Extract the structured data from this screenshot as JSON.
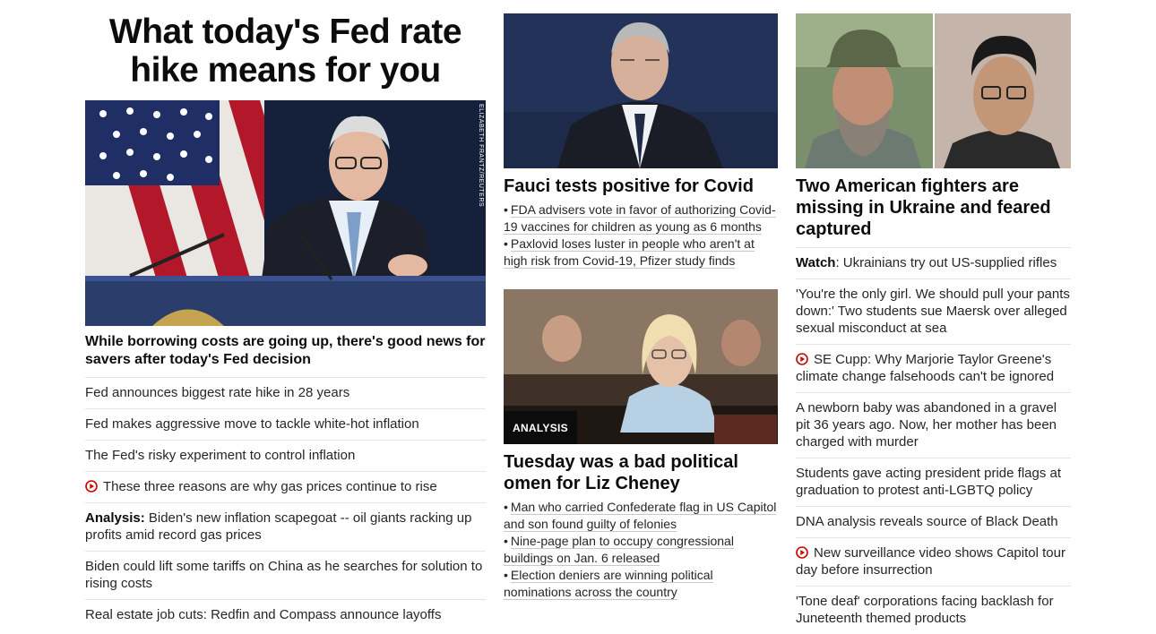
{
  "column1": {
    "headline": "What today's Fed rate hike means for you",
    "photo_credit": "ELIZABETH FRANTZ/REUTERS",
    "hero_subtitle": "While borrowing costs are going up, there's good news for savers after today's Fed decision",
    "links": [
      {
        "prefix": "",
        "text": "Fed announces biggest rate hike in 28 years",
        "video": false
      },
      {
        "prefix": "",
        "text": "Fed makes aggressive move to tackle white-hot inflation",
        "video": false
      },
      {
        "prefix": "",
        "text": "The Fed's risky experiment to control inflation",
        "video": false
      },
      {
        "prefix": "",
        "text": "These three reasons are why gas prices continue to rise",
        "video": true
      },
      {
        "prefix": "Analysis:",
        "text": " Biden's new inflation scapegoat -- oil giants racking up profits amid record gas prices",
        "video": false
      },
      {
        "prefix": "",
        "text": "Biden could lift some tariffs on China as he searches for solution to rising costs",
        "video": false
      },
      {
        "prefix": "",
        "text": "Real estate job cuts: Redfin and Compass announce layoffs",
        "video": false
      }
    ]
  },
  "column2": {
    "story1": {
      "title": "Fauci tests positive for Covid",
      "bullets": [
        "FDA advisers vote in favor of authorizing Covid-19 vaccines for children as young as 6 months",
        "Paxlovid loses luster in people who aren't at high risk from Covid-19, Pfizer study finds"
      ]
    },
    "story2": {
      "badge": "ANALYSIS",
      "title": "Tuesday was a bad political omen for Liz Cheney",
      "bullets": [
        "Man who carried Confederate flag in US Capitol and son found guilty of felonies",
        "Nine-page plan to occupy congressional buildings on Jan. 6 released",
        "Election deniers are winning political nominations across the country"
      ]
    }
  },
  "column3": {
    "title": "Two American fighters are missing in Ukraine and feared captured",
    "links": [
      {
        "prefix": "Watch",
        "text": ": Ukrainians try out US-supplied rifles",
        "video": false
      },
      {
        "prefix": "",
        "text": "'You're the only girl. We should pull your pants down:' Two students sue Maersk over alleged sexual misconduct at sea",
        "video": false
      },
      {
        "prefix": "",
        "text": "SE Cupp: Why Marjorie Taylor Greene's climate change falsehoods can't be ignored",
        "video": true
      },
      {
        "prefix": "",
        "text": "A newborn baby was abandoned in a gravel pit 36 years ago. Now, her mother has been charged with murder",
        "video": false
      },
      {
        "prefix": "",
        "text": "Students gave acting president pride flags at graduation to protest anti-LGBTQ policy",
        "video": false
      },
      {
        "prefix": "",
        "text": "DNA analysis reveals source of Black Death",
        "video": false
      },
      {
        "prefix": "",
        "text": "New surveillance video shows Capitol tour day before insurrection",
        "video": true
      },
      {
        "prefix": "",
        "text": "'Tone deaf' corporations facing backlash for Juneteenth themed products",
        "video": false
      }
    ]
  },
  "colors": {
    "text": "#0c0c0c",
    "link": "#262626",
    "divider": "#e6e6e6",
    "video_red": "#cc0000",
    "badge_bg": "#0c0c0c"
  }
}
